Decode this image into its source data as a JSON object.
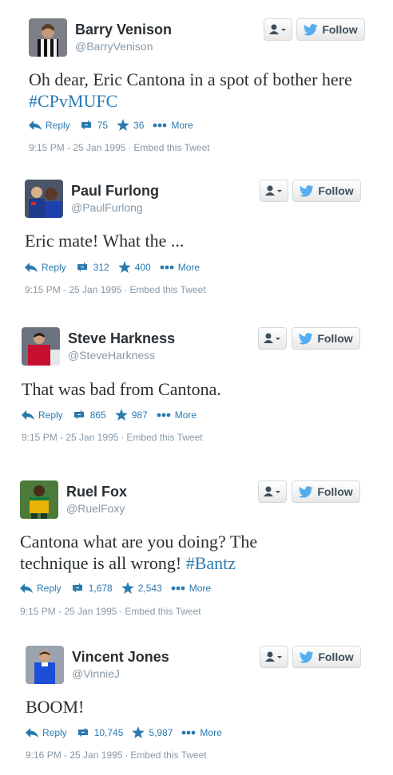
{
  "colors": {
    "link": "#2a7ab0",
    "muted": "#8899a6",
    "text": "#292f33",
    "twitter_bird": "#55acee"
  },
  "icons": {
    "reply": "reply-arrow-icon",
    "retweet": "retweet-icon",
    "favorite": "star-icon",
    "more": "ellipsis-icon",
    "user_menu": "person-dropdown-icon",
    "follow": "twitter-bird-icon"
  },
  "tweets": [
    {
      "name": "Barry Venison",
      "handle": "@BarryVenison",
      "text": "Oh dear, Eric Cantona in a spot of bother here ",
      "hashtag": "#CPvMUFC",
      "reply": "Reply",
      "retweets": "75",
      "favorites": "36",
      "more": "More",
      "timestamp": "9:15 PM - 25 Jan 1995",
      "separator": "·",
      "embed": "Embed this Tweet",
      "follow": "Follow"
    },
    {
      "name": "Paul Furlong",
      "handle": "@PaulFurlong",
      "text": "Eric mate! What the ...",
      "hashtag": "",
      "reply": "Reply",
      "retweets": "312",
      "favorites": "400",
      "more": "More",
      "timestamp": "9:15 PM - 25 Jan 1995",
      "separator": "·",
      "embed": "Embed this Tweet",
      "follow": "Follow"
    },
    {
      "name": "Steve Harkness",
      "handle": "@SteveHarkness",
      "text": "That was bad from Cantona.",
      "hashtag": "",
      "reply": "Reply",
      "retweets": "865",
      "favorites": "987",
      "more": "More",
      "timestamp": "9:15 PM - 25 Jan 1995",
      "separator": "·",
      "embed": "Embed this Tweet",
      "follow": "Follow"
    },
    {
      "name": "Ruel Fox",
      "handle": "@RuelFoxy",
      "text": "Cantona what are you doing? The technique is all wrong! ",
      "hashtag": "#Bantz",
      "reply": "Reply",
      "retweets": "1,678",
      "favorites": "2,543",
      "more": "More",
      "timestamp": "9:15 PM - 25 Jan 1995",
      "separator": "·",
      "embed": "Embed this Tweet",
      "follow": "Follow"
    },
    {
      "name": "Vincent Jones",
      "handle": "@VinnieJ",
      "text": "BOOM!",
      "hashtag": "",
      "reply": "Reply",
      "retweets": "10,745",
      "favorites": "5,987",
      "more": "More",
      "timestamp": "9:16 PM - 25 Jan 1995",
      "separator": "·",
      "embed": "Embed this Tweet",
      "follow": "Follow"
    }
  ]
}
